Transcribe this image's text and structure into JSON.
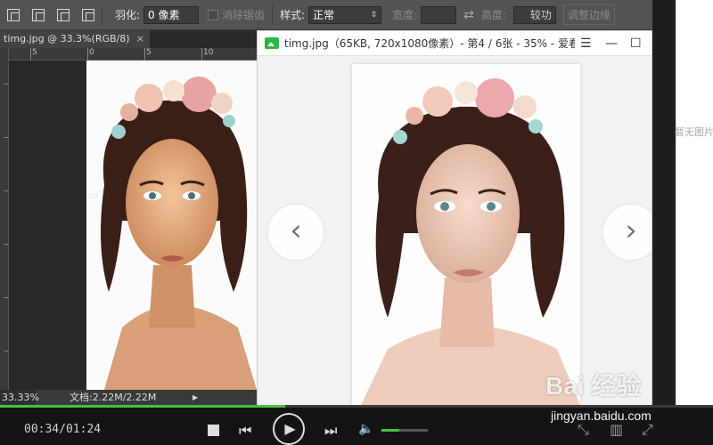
{
  "ps_options": {
    "feather_label": "羽化:",
    "feather_value": "0 像素",
    "antialias_label": "消除锯齿",
    "style_label": "样式:",
    "style_value": "正常",
    "width_label": "宽度:",
    "height_label": "高度:",
    "height_value_partial": "较功",
    "refine_button": "调整边缘"
  },
  "ps_document": {
    "tab_title": "timg.jpg @ 33.3%(RGB/8)",
    "tab_close": "×",
    "ruler_numbers": [
      "5",
      "0",
      "5",
      "10"
    ],
    "zoom": "33.33%",
    "doc_info": "文档:2.22M/2.22M"
  },
  "viewer": {
    "title": "timg.jpg（65KB, 720x1080像素）- 第4 / 6张 - 35% - 爱看",
    "menu_icon": "☰",
    "minimize_icon": "—",
    "maximize_icon": "☐",
    "prev_icon": "‹",
    "next_icon": "›"
  },
  "right_page": {
    "hint": "暂无图片"
  },
  "player": {
    "time": "00:34/01:24",
    "progress_fraction": 0.4,
    "volume_fraction": 0.38
  },
  "watermark": {
    "logo": "Bai 经验",
    "url": "jingyan.baidu.com"
  },
  "colors": {
    "accent": "#4bbd3e",
    "viewer_icon": "#2fb24a"
  }
}
